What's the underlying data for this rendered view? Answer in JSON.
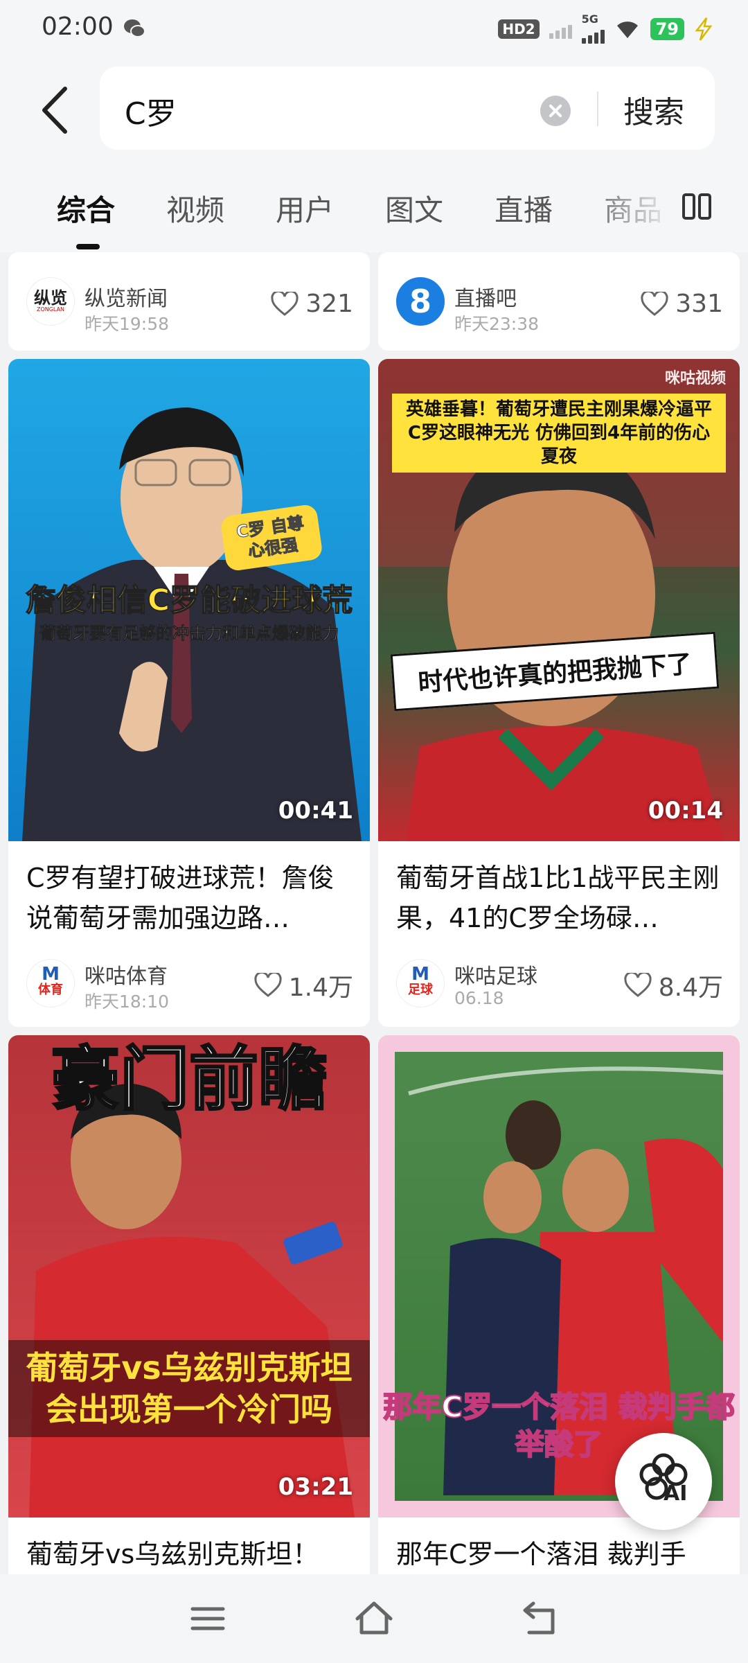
{
  "status_bar": {
    "time": "02:00",
    "hd": "HD2",
    "network": "5G",
    "battery": "79"
  },
  "search": {
    "query": "C罗",
    "submit_label": "搜索"
  },
  "tabs": [
    "综合",
    "视频",
    "用户",
    "图文",
    "直播",
    "商品"
  ],
  "top_cards": [
    {
      "source": "纵览新闻",
      "logo_text": "纵览",
      "logo_sub": "ZONGLAN",
      "time": "昨天19:58",
      "likes": "321"
    },
    {
      "source": "直播吧",
      "logo_text": "8",
      "time": "昨天23:38",
      "likes": "331"
    }
  ],
  "video_cards": [
    {
      "duration": "00:41",
      "overlay_main": "詹俊相信C罗能破进球荒",
      "overlay_sub": "葡萄牙要有足够的冲击力和单点爆破能力",
      "badge": "C罗 自尊心很强",
      "title": "C罗有望打破进球荒！詹俊说葡萄牙需加强边路…",
      "source": "咪咕体育",
      "logo_label": "体育",
      "time": "昨天18:10",
      "likes": "1.4万"
    },
    {
      "duration": "00:14",
      "overlay_banner": "英雄垂暮！葡萄牙遭民主刚果爆冷逼平 C罗这眼神无光 仿佛回到4年前的伤心夏夜",
      "overlay_main": "时代也许真的把我抛下了",
      "watermark": "咪咕视频",
      "title": "葡萄牙首战1比1战平民主刚果，41的C罗全场碌…",
      "source": "咪咕足球",
      "logo_label": "足球",
      "time": "06.18",
      "likes": "8.4万"
    },
    {
      "duration": "03:21",
      "overlay_top": "豪门前瞻",
      "overlay_main": "葡萄牙vs乌兹别克斯坦 会出现第一个冷门吗",
      "title": "葡萄牙vs乌兹别克斯坦！"
    },
    {
      "overlay_main": "那年C罗一个落泪 裁判手都举酸了",
      "title": "那年C罗一个落泪 裁判手"
    }
  ],
  "ai_button": {
    "label": "AI"
  },
  "colors": {
    "accent": "#111111",
    "battery": "#2ec25b",
    "migu_red": "#e0251b",
    "migu_blue": "#1f5db8"
  }
}
